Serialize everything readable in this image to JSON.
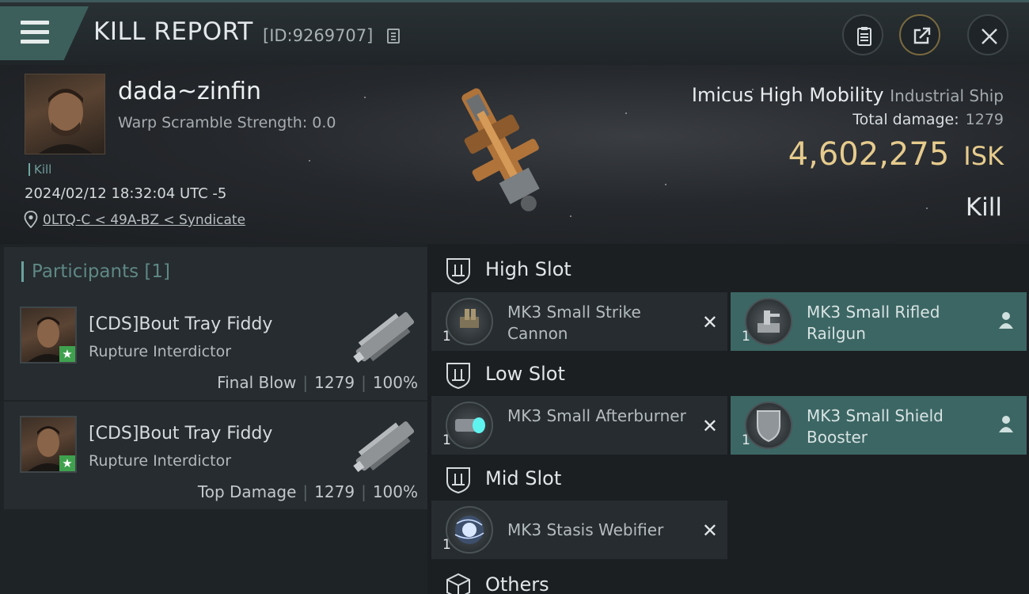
{
  "header": {
    "title": "KILL REPORT",
    "report_id": "[ID:9269707]",
    "menu_icon": "hamburger-menu-icon",
    "buttons": [
      "clipboard-icon",
      "share-icon",
      "close-icon"
    ]
  },
  "victim": {
    "name": "dada~zinfin",
    "warp_scramble": "Warp Scramble Strength: 0.0",
    "kill_tag": "Kill",
    "timestamp": "2024/02/12 18:32:04 UTC -5",
    "location": "0LTQ-C < 49A-BZ < Syndicate"
  },
  "ship": {
    "name": "Imicus High Mobility",
    "class": "Industrial Ship",
    "total_damage_label": "Total damage:",
    "total_damage": "1279",
    "isk_value": "4,602,275",
    "isk_unit": "ISK",
    "result": "Kill"
  },
  "participants": {
    "header": "Participants [1]",
    "rows": [
      {
        "name": "[CDS]Bout Tray Fiddy",
        "ship": "Rupture Interdictor",
        "role": "Final Blow",
        "damage": "1279",
        "percent": "100%"
      },
      {
        "name": "[CDS]Bout Tray Fiddy",
        "ship": "Rupture Interdictor",
        "role": "Top Damage",
        "damage": "1279",
        "percent": "100%"
      }
    ]
  },
  "slots": {
    "high": {
      "label": "High Slot",
      "items": [
        {
          "name": "MK3 Small Strike Cannon",
          "qty": "1",
          "state": "destroyed"
        },
        {
          "name": "MK3 Small Rifled Railgun",
          "qty": "1",
          "state": "fitted"
        }
      ]
    },
    "low": {
      "label": "Low Slot",
      "items": [
        {
          "name": "MK3 Small Afterburner",
          "qty": "1",
          "state": "destroyed"
        },
        {
          "name": "MK3 Small Shield Booster",
          "qty": "1",
          "state": "fitted"
        }
      ]
    },
    "mid": {
      "label": "Mid Slot",
      "items": [
        {
          "name": "MK3 Stasis Webifier",
          "qty": "1",
          "state": "destroyed"
        }
      ]
    },
    "others": {
      "label": "Others"
    }
  },
  "glyphs": {
    "destroyed": "✕",
    "badge": "★"
  },
  "colors": {
    "accent_teal": "#3c6664",
    "isk_gold": "#e6cb8d",
    "badge_green": "#3fa14e"
  }
}
